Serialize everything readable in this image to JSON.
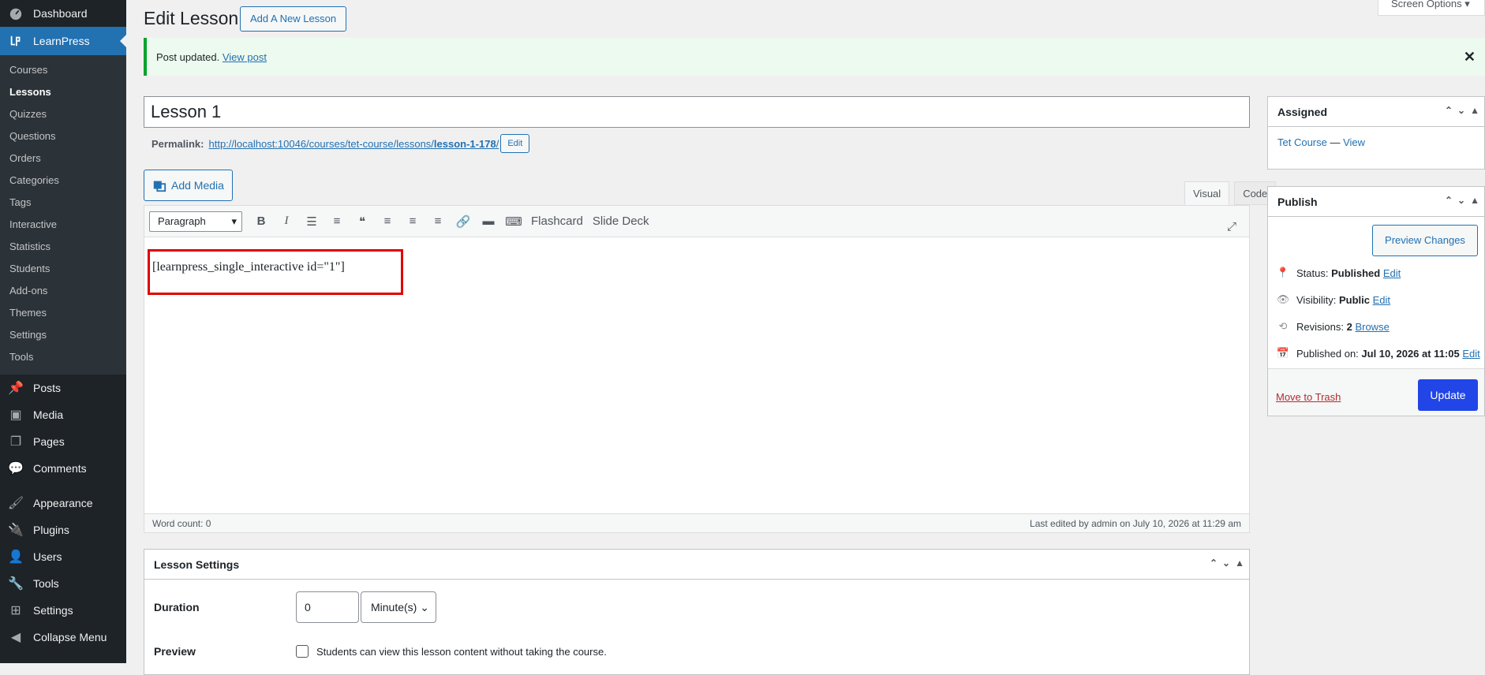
{
  "sidebar": {
    "dashboard": "Dashboard",
    "learnpress": "LearnPress",
    "sub_items": [
      "Courses",
      "Lessons",
      "Quizzes",
      "Questions",
      "Orders",
      "Categories",
      "Tags",
      "Interactive",
      "Statistics",
      "Students",
      "Add-ons",
      "Themes",
      "Settings",
      "Tools"
    ],
    "items": [
      "Posts",
      "Media",
      "Pages",
      "Comments",
      "Appearance",
      "Plugins",
      "Users",
      "Tools",
      "Settings",
      "Collapse Menu"
    ],
    "accent": "#2271b1"
  },
  "header": {
    "title": "Edit Lesson",
    "add_new": "Add A New Lesson",
    "screen_options": "Screen Options"
  },
  "notice": {
    "text": "Post updated.",
    "link": "View post"
  },
  "post": {
    "title": "Lesson 1",
    "permalink_label": "Permalink:",
    "permalink_base": "http://localhost:10046/courses/tet-course/lessons/",
    "permalink_slug": "lesson-1-178",
    "permalink_end": "/",
    "permalink_edit": "Edit"
  },
  "editor": {
    "add_media": "Add Media",
    "tab_visual": "Visual",
    "tab_code": "Code",
    "format": "Paragraph",
    "flashcard": "Flashcard",
    "slide_deck": "Slide Deck",
    "content": "[learnpress_single_interactive id=\"1\"]",
    "word_count": "Word count: 0",
    "last_edited": "Last edited by admin on July 10, 2026 at 11:29 am"
  },
  "lesson_settings": {
    "title": "Lesson Settings",
    "duration_label": "Duration",
    "duration_value": "0",
    "duration_unit": "Minute(s)",
    "preview_label": "Preview",
    "preview_text": "Students can view this lesson content without taking the course."
  },
  "assigned": {
    "title": "Assigned",
    "course": "Tet Course",
    "sep": " — ",
    "view": "View"
  },
  "publish": {
    "title": "Publish",
    "preview_changes": "Preview Changes",
    "status_label": "Status:",
    "status_value": "Published",
    "visibility_label": "Visibility:",
    "visibility_value": "Public",
    "revisions_label": "Revisions:",
    "revisions_value": "2",
    "browse": "Browse",
    "published_label": "Published on:",
    "published_value": "Jul 10, 2026 at 11:05",
    "edit": "Edit",
    "trash": "Move to Trash",
    "update": "Update"
  }
}
